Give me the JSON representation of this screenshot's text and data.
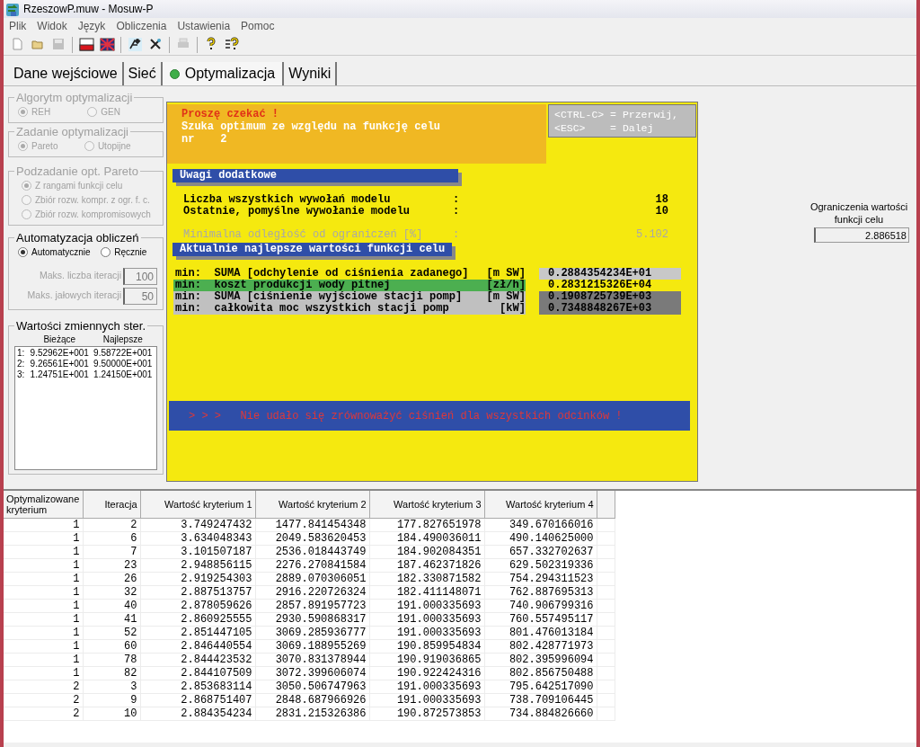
{
  "window": {
    "title": "RzeszowP.muw - Mosuw-P"
  },
  "menu": [
    "Plik",
    "Widok",
    "Język",
    "Obliczenia",
    "Ustawienia",
    "Pomoc"
  ],
  "toolbar": [
    {
      "kind": "new",
      "disabled": false
    },
    {
      "kind": "open",
      "disabled": false
    },
    {
      "kind": "save",
      "disabled": true
    },
    {
      "kind": "flag-pl",
      "disabled": false
    },
    {
      "kind": "flag-uk",
      "disabled": false
    },
    {
      "kind": "run",
      "disabled": false
    },
    {
      "kind": "tools",
      "disabled": false
    },
    {
      "kind": "print",
      "disabled": true
    },
    {
      "kind": "help",
      "disabled": false
    },
    {
      "kind": "help-list",
      "disabled": false
    }
  ],
  "tabs": [
    {
      "label": "Dane wejściowe",
      "selected": false,
      "led": false
    },
    {
      "label": "Sieć",
      "selected": false,
      "led": false
    },
    {
      "label": "Optymalizacja",
      "selected": true,
      "led": true
    },
    {
      "label": "Wyniki",
      "selected": false,
      "led": false
    }
  ],
  "algorithm": {
    "title": "Algorytm optymalizacji",
    "disabled": true,
    "options": [
      {
        "label": "REH",
        "selected": true
      },
      {
        "label": "GEN",
        "selected": false
      }
    ]
  },
  "task": {
    "title": "Zadanie optymalizacji",
    "disabled": true,
    "options": [
      {
        "label": "Pareto",
        "selected": true
      },
      {
        "label": "Utopijne",
        "selected": false
      }
    ]
  },
  "subtask": {
    "title": "Podzadanie opt. Pareto",
    "disabled": true,
    "options": [
      {
        "label": "Z rangami funkcji celu",
        "selected": true
      },
      {
        "label": "Zbiór rozw. kompr. z ogr. f. c.",
        "selected": false
      },
      {
        "label": "Zbiór rozw. kompromisowych",
        "selected": false
      }
    ]
  },
  "automation": {
    "title": "Automatyzacja obliczeń",
    "disabled": false,
    "options": [
      {
        "label": "Automatycznie",
        "selected": true
      },
      {
        "label": "Ręcznie",
        "selected": false
      }
    ],
    "fields": [
      {
        "label": "Maks. liczba iteracji",
        "value": "100",
        "disabled": true
      },
      {
        "label": "Maks. jałowych iteracji",
        "value": "50",
        "disabled": true
      }
    ]
  },
  "variables": {
    "title": "Wartości zmiennych ster.",
    "columns": [
      "",
      "Bieżące",
      "Najlepsze"
    ],
    "rows": [
      [
        "1:",
        "9.52962E+001",
        "9.58722E+001"
      ],
      [
        "2:",
        "9.26561E+001",
        "9.50000E+001"
      ],
      [
        "3:",
        "1.24751E+001",
        "1.24150E+001"
      ]
    ]
  },
  "console": {
    "status": "Proszę czekać !",
    "lines": [
      "Szuka optimum ze względu na funkcję celu",
      "nr    2"
    ],
    "keys": [
      "<CTRL-C> = Przerwij,",
      "<ESC>    = Dalej"
    ],
    "remarks_title": "Uwagi dodatkowe",
    "stats": [
      {
        "label": "Liczba wszystkich wywołań modelu",
        "separator": ":",
        "value": "18",
        "disabled": false
      },
      {
        "label": "Ostatnie, pomyślne wywołanie modelu",
        "separator": ":",
        "value": "10",
        "disabled": false
      },
      {
        "label": "Minimalna odległość od ograniczeń [%]",
        "separator": ":",
        "value": "5.102",
        "disabled": true
      }
    ],
    "best_title": "Aktualnie najlepsze wartości funkcji celu",
    "objectives": [
      {
        "prefix": "min:",
        "label": "SUMA [odchylenie od ciśnienia zadanego]",
        "unit": "[m SW]",
        "color": "#f5e90f",
        "result": {
          "value": "0.2884354234E+01",
          "color": "#c8c8c8"
        }
      },
      {
        "prefix": "min:",
        "label": "koszt produkcji wody pitnej",
        "unit": "[zł/h]",
        "color": "#4caf50",
        "result": {
          "value": "0.2831215326E+04",
          "color": "#f5e90f"
        }
      },
      {
        "prefix": "min:",
        "label": "SUMA [ciśnienie wyjściowe stacji pomp]",
        "unit": "[m SW]",
        "color": "#c0c0c0",
        "result": {
          "value": "0.1908725739E+03",
          "color": "#7a7a7a"
        }
      },
      {
        "prefix": "min:",
        "label": "całkowita moc wszystkich stacji pomp",
        "unit": "[kW]",
        "color": "#c0c0c0",
        "result": {
          "value": "0.7348848267E+03",
          "color": "#7a7a7a"
        }
      }
    ],
    "message": "> > >   Nie udało się zrównoważyć ciśnień dla wszystkich odcinków !"
  },
  "constraint": {
    "label": "Ograniczenia wartości funkcji celu",
    "value": "2.886518"
  },
  "table": {
    "columns": [
      "Optymalizowane kryterium",
      "Iteracja",
      "Wartość kryterium 1",
      "Wartość kryterium 2",
      "Wartość kryterium 3",
      "Wartość kryterium 4"
    ],
    "rows": [
      [
        "1",
        "2",
        "3.749247432",
        "1477.841454348",
        "177.827651978",
        "349.670166016"
      ],
      [
        "1",
        "6",
        "3.634048343",
        "2049.583620453",
        "184.490036011",
        "490.140625000"
      ],
      [
        "1",
        "7",
        "3.101507187",
        "2536.018443749",
        "184.902084351",
        "657.332702637"
      ],
      [
        "1",
        "23",
        "2.948856115",
        "2276.270841584",
        "187.462371826",
        "629.502319336"
      ],
      [
        "1",
        "26",
        "2.919254303",
        "2889.070306051",
        "182.330871582",
        "754.294311523"
      ],
      [
        "1",
        "32",
        "2.887513757",
        "2916.220726324",
        "182.411148071",
        "762.887695313"
      ],
      [
        "1",
        "40",
        "2.878059626",
        "2857.891957723",
        "191.000335693",
        "740.906799316"
      ],
      [
        "1",
        "41",
        "2.860925555",
        "2930.590868317",
        "191.000335693",
        "760.557495117"
      ],
      [
        "1",
        "52",
        "2.851447105",
        "3069.285936777",
        "191.000335693",
        "801.476013184"
      ],
      [
        "1",
        "60",
        "2.846440554",
        "3069.188955269",
        "190.859954834",
        "802.428771973"
      ],
      [
        "1",
        "78",
        "2.844423532",
        "3070.831378944",
        "190.919036865",
        "802.395996094"
      ],
      [
        "1",
        "82",
        "2.844107509",
        "3072.399606074",
        "190.922424316",
        "802.856750488"
      ],
      [
        "2",
        "3",
        "2.853683114",
        "3050.506747963",
        "191.000335693",
        "795.642517090"
      ],
      [
        "2",
        "9",
        "2.868751407",
        "2848.687966926",
        "191.000335693",
        "738.709106445"
      ],
      [
        "2",
        "10",
        "2.884354234",
        "2831.215326386",
        "190.872573853",
        "734.884826660"
      ]
    ]
  }
}
